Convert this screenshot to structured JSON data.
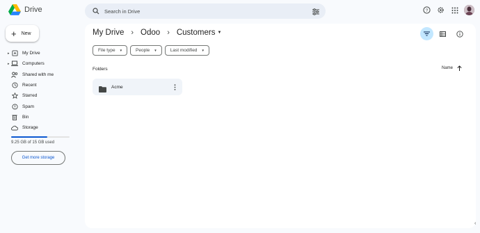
{
  "app": {
    "name": "Drive"
  },
  "search": {
    "placeholder": "Search in Drive"
  },
  "sidebar": {
    "new_label": "New",
    "items": [
      {
        "label": "My Drive",
        "expandable": true,
        "icon": "my-drive-icon"
      },
      {
        "label": "Computers",
        "expandable": true,
        "icon": "computer-icon"
      },
      {
        "label": "Shared with me",
        "expandable": false,
        "icon": "people-icon"
      },
      {
        "label": "Recent",
        "expandable": false,
        "icon": "clock-icon"
      },
      {
        "label": "Starred",
        "expandable": false,
        "icon": "star-icon"
      },
      {
        "label": "Spam",
        "expandable": false,
        "icon": "spam-icon"
      },
      {
        "label": "Bin",
        "expandable": false,
        "icon": "bin-icon"
      },
      {
        "label": "Storage",
        "expandable": false,
        "icon": "cloud-icon"
      }
    ],
    "storage_used_fraction": 0.62,
    "storage_text": "9.25 GB of 15 GB used",
    "get_storage_label": "Get more storage"
  },
  "breadcrumb": [
    "My Drive",
    "Odoo",
    "Customers"
  ],
  "filters": [
    "File type",
    "People",
    "Last modified"
  ],
  "folders_label": "Folders",
  "sort_label": "Name",
  "folders": [
    {
      "name": "Acme"
    }
  ],
  "colors": {
    "accent": "#0b57d0",
    "selected_toggle": "#c2e7ff",
    "page_bg": "#f8fafd",
    "card_bg": "#f0f4f9"
  }
}
